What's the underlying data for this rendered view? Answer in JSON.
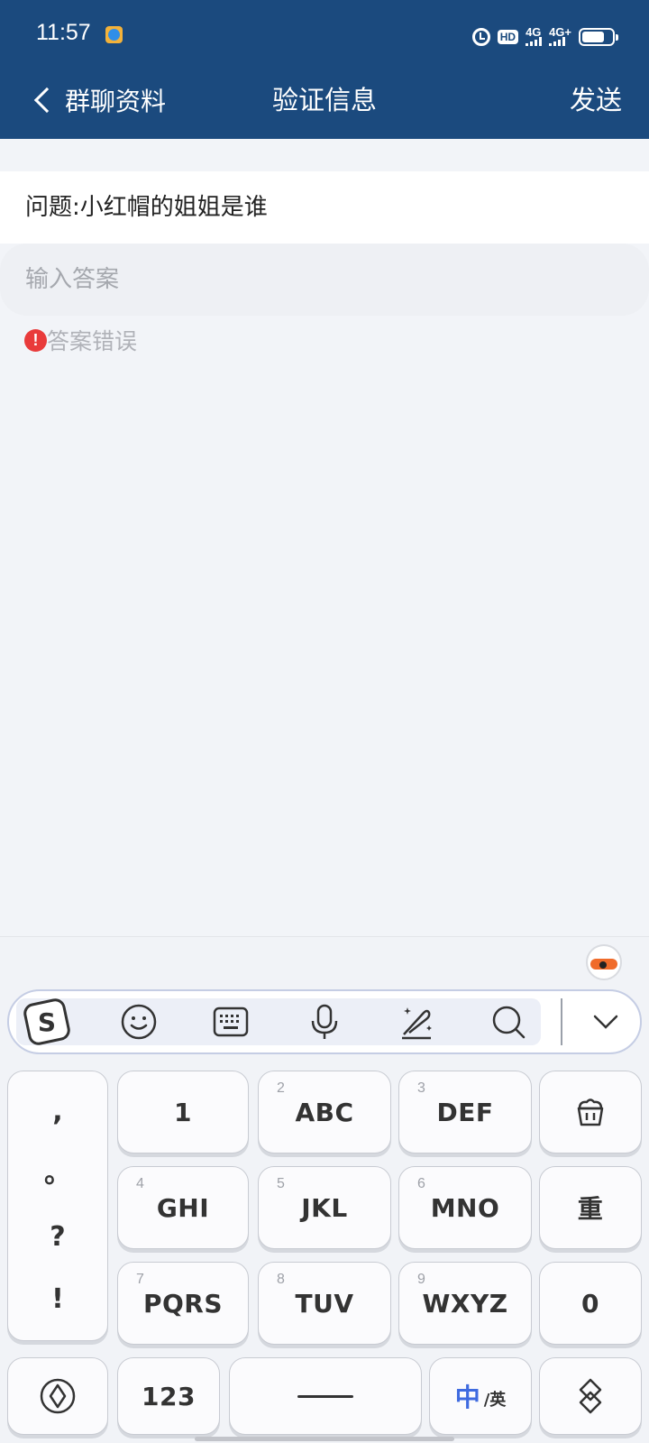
{
  "status_bar": {
    "time": "11:57",
    "icons": [
      "app-notification-icon",
      "alarm-icon",
      "hd-icon",
      "signal-4g-icon",
      "signal-4g-plus-icon",
      "battery-icon"
    ],
    "hd_label": "HD",
    "network_1": "4G",
    "network_2": "4G+",
    "battery_level": 0.75
  },
  "nav": {
    "back_label": "群聊资料",
    "title": "验证信息",
    "send_label": "发送"
  },
  "question": {
    "text": "问题:小红帽的姐姐是谁"
  },
  "answer": {
    "placeholder": "输入答案",
    "value": ""
  },
  "error": {
    "icon": "!",
    "text": "答案错误"
  },
  "keyboard": {
    "toolbar": [
      "sogou-logo-icon",
      "emoji-icon",
      "keyboard-icon",
      "microphone-icon",
      "handwriting-icon",
      "search-icon",
      "collapse-icon"
    ],
    "punctuation": [
      ",",
      "。",
      "?",
      "!"
    ],
    "keys": {
      "k1": {
        "main": "1",
        "num": ""
      },
      "k2": {
        "main": "ABC",
        "num": "2"
      },
      "k3": {
        "main": "DEF",
        "num": "3"
      },
      "k4": {
        "main": "GHI",
        "num": "4"
      },
      "k5": {
        "main": "JKL",
        "num": "5"
      },
      "k6": {
        "main": "MNO",
        "num": "6"
      },
      "k7": {
        "main": "PQRS",
        "num": "7"
      },
      "k8": {
        "main": "TUV",
        "num": "8"
      },
      "k9": {
        "main": "WXYZ",
        "num": "9"
      },
      "zero": "0",
      "redo": "重",
      "numbers": "123",
      "lang_main": "中",
      "lang_sub": "/英"
    },
    "accent_color": "#3f6be0"
  },
  "colors": {
    "header_bg": "#1b4a7e",
    "page_bg": "#f2f4f8",
    "error_icon": "#e93b3b"
  }
}
